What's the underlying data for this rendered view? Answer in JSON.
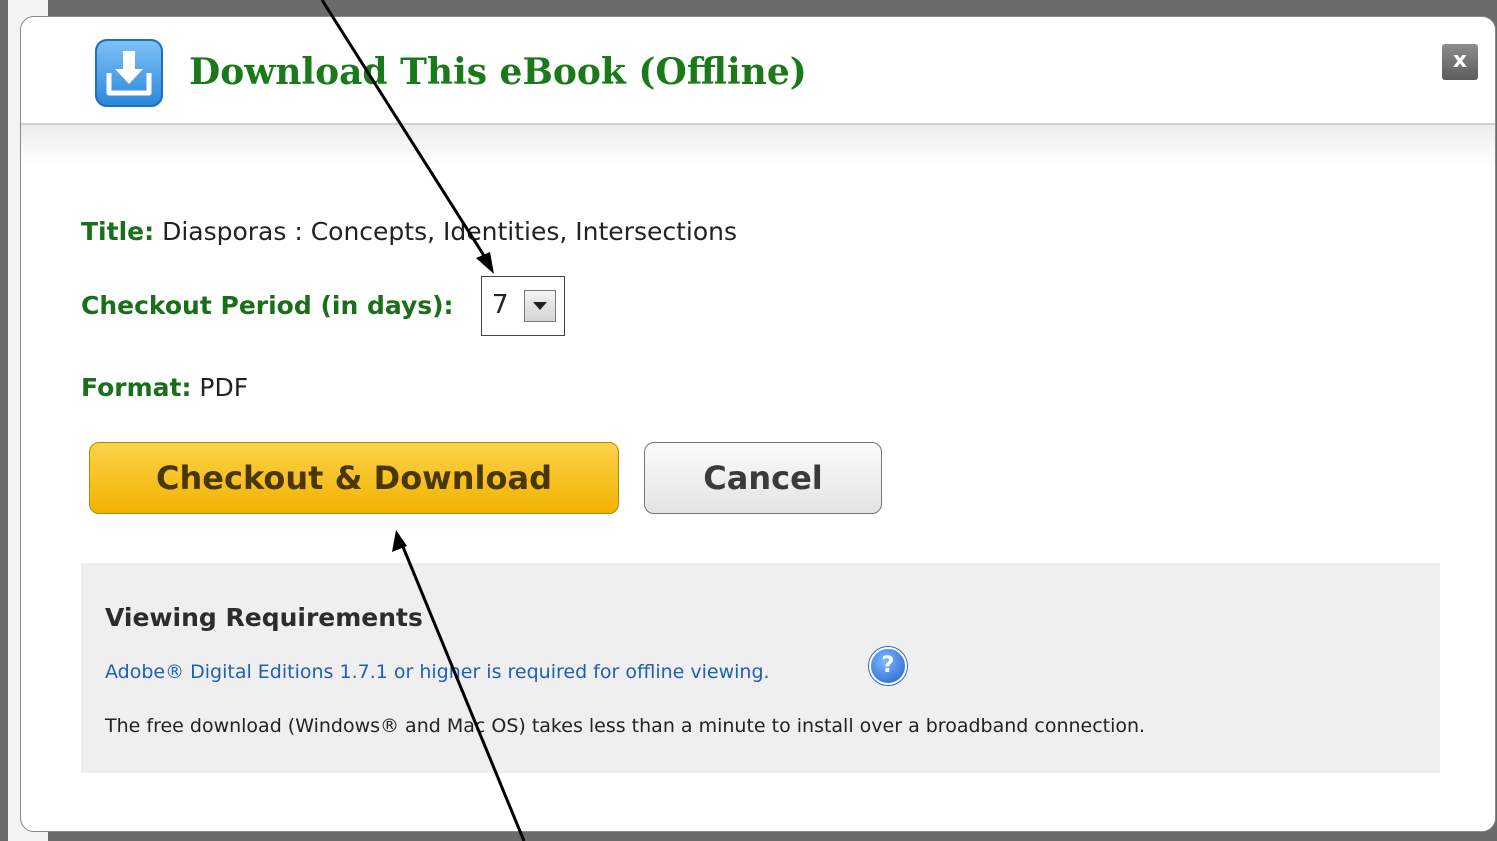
{
  "dialog": {
    "title": "Download This eBook (Offline)",
    "header_icon": "download-icon",
    "close_label": "x"
  },
  "fields": {
    "title_label": "Title:",
    "title_value": "Diasporas : Concepts, Identities, Intersections",
    "period_label": "Checkout Period (in days):",
    "period_value": "7",
    "format_label": "Format:",
    "format_value": "PDF"
  },
  "buttons": {
    "checkout_label": "Checkout & Download",
    "cancel_label": "Cancel"
  },
  "requirements": {
    "heading": "Viewing Requirements",
    "link_text": "Adobe® Digital Editions 1.7.1 or higher is required for offline viewing.",
    "help_icon": "question-mark-icon",
    "help_glyph": "?",
    "description": "The free download (Windows® and Mac OS) takes less than a minute to install over a broadband connection."
  },
  "colors": {
    "title_green": "#1a7a1a",
    "primary_button": "#f2b300",
    "link_blue": "#1f5fb5",
    "panel_gray": "#efefef"
  }
}
